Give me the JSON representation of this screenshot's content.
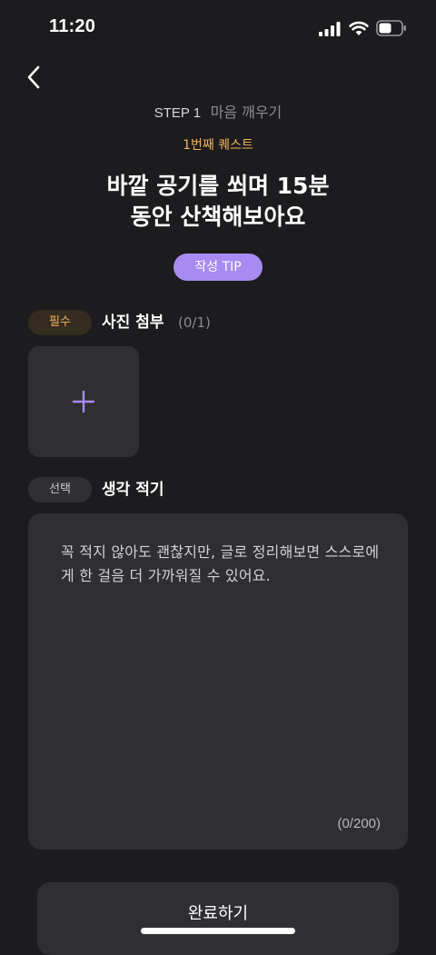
{
  "status_bar": {
    "time": "11:20",
    "icons": [
      "signal-icon",
      "wifi-icon",
      "battery-icon"
    ]
  },
  "header": {
    "back_icon": "chevron-left-icon",
    "step_label": "STEP 1",
    "step_title": "마음 깨우기",
    "quest_label": "1번째 퀘스트",
    "quest_title": "바깥 공기를 쐬며 15분\n동안 산책해보아요",
    "tip_label": "작성 TIP"
  },
  "photo_section": {
    "badge": "필수",
    "title": "사진 첨부",
    "count": "(0/1)",
    "add_icon": "plus-icon"
  },
  "thought_section": {
    "badge": "선택",
    "title": "생각 적기",
    "placeholder": "꼭 적지 않아도 괜찮지만, 글로 정리해보면 스스로에게 한 걸음 더 가까워질 수 있어요.",
    "counter": "(0/200)"
  },
  "footer": {
    "complete_label": "완료하기"
  },
  "colors": {
    "background": "#1c1b1e",
    "surface": "#2f2e33",
    "accent_purple": "#a78bf2",
    "accent_gold": "#f1b65e",
    "muted_text": "#8c8b90"
  }
}
